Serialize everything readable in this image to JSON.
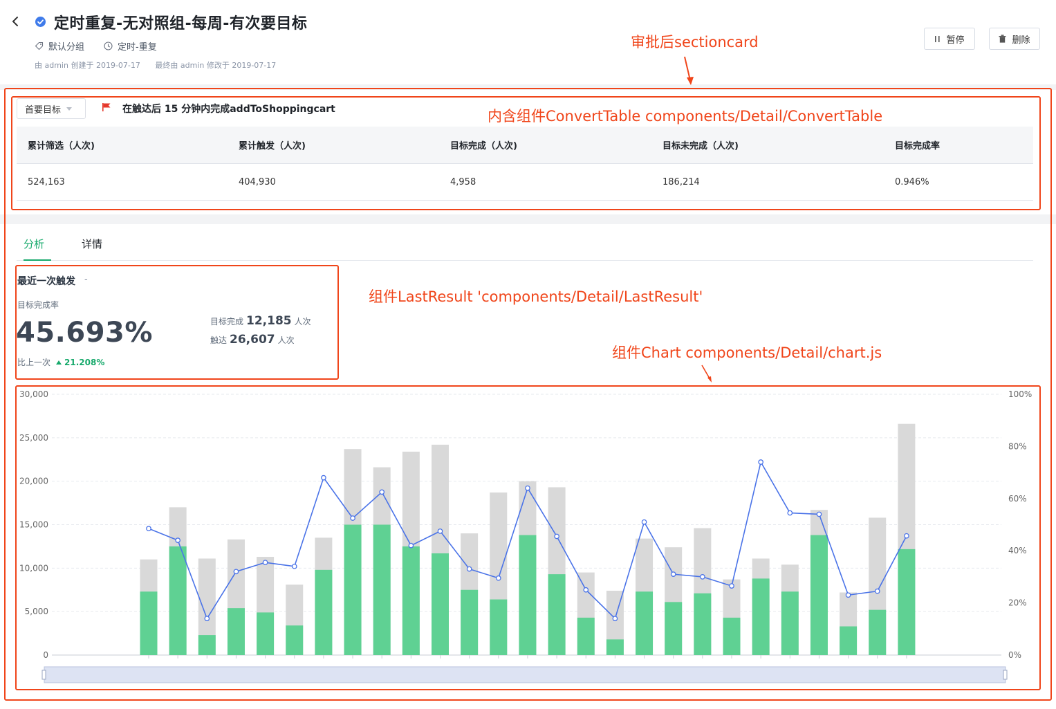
{
  "header": {
    "title": "定时重复-无对照组-每周-有次要目标",
    "group": "默认分组",
    "schedule": "定时-重复",
    "created": "由 admin 创建于 2019-07-17",
    "modified": "最终由 admin 修改于 2019-07-17",
    "pause_label": "暂停",
    "delete_label": "删除"
  },
  "goal": {
    "select_value": "首要目标",
    "description": "在触达后 15 分钟内完成addToShoppingcart"
  },
  "convert_table": {
    "columns": [
      "累计筛选（人次)",
      "累计触发（人次)",
      "目标完成（人次)",
      "目标未完成（人次)",
      "目标完成率"
    ],
    "row": [
      "524,163",
      "404,930",
      "4,958",
      "186,214",
      "0.946%"
    ]
  },
  "tabs": {
    "analysis": "分析",
    "detail": "详情"
  },
  "last_result": {
    "title": "最近一次触发",
    "dash": "-",
    "rate_label": "目标完成率",
    "rate": "45.693%",
    "compare_label": "比上一次",
    "compare_value": "21.208%",
    "done_label": "目标完成",
    "done_value": "12,185",
    "trigger_label": "触达",
    "trigger_value": "26,607",
    "unit": "人次"
  },
  "annotations": {
    "section_card": "审批后sectioncard",
    "convert_table": "内含组件ConvertTable  components/Detail/ConvertTable",
    "last_result": "组件LastResult  'components/Detail/LastResult'",
    "chart": "组件Chart   components/Detail/chart.js"
  },
  "colors": {
    "accent": "#16a96b",
    "bar_done": "#5fd193",
    "bar_total": "#d9d9d9",
    "line": "#4a73e8",
    "annotation": "#f0451a"
  },
  "chart_data": {
    "type": "bar",
    "y_left": {
      "ylim": [
        0,
        30000
      ],
      "ticks": [
        "0",
        "5,000",
        "10,000",
        "15,000",
        "20,000",
        "25,000",
        "30,000"
      ]
    },
    "y_right": {
      "ylim": [
        0,
        100
      ],
      "ticks": [
        "0%",
        "20%",
        "40%",
        "60%",
        "80%",
        "100%"
      ]
    },
    "grid": true,
    "series": [
      {
        "kind": "bar",
        "values": [
          11000,
          17000,
          11100,
          13300,
          11300,
          8100,
          13500,
          23700,
          21600,
          23400,
          24200,
          14000,
          18700,
          20000,
          19300,
          9500,
          7400,
          13400,
          12400,
          14600,
          8700,
          11100,
          10400,
          16700,
          7200,
          15800,
          26600
        ]
      },
      {
        "kind": "bar",
        "values": [
          7300,
          12500,
          2300,
          5400,
          4900,
          3400,
          9800,
          15000,
          15000,
          12500,
          11700,
          7500,
          6400,
          13800,
          9300,
          4300,
          1800,
          7300,
          6100,
          7100,
          4300,
          8800,
          7300,
          13800,
          3300,
          5200,
          12185
        ]
      },
      {
        "kind": "line",
        "values": [
          48.5,
          44,
          14,
          32,
          35.5,
          34,
          68,
          52.5,
          62.5,
          42,
          47.5,
          33,
          29.5,
          64,
          45.5,
          25,
          14,
          51,
          31,
          30,
          26.5,
          74,
          54.5,
          54,
          23,
          24.5,
          45.693
        ]
      }
    ]
  }
}
